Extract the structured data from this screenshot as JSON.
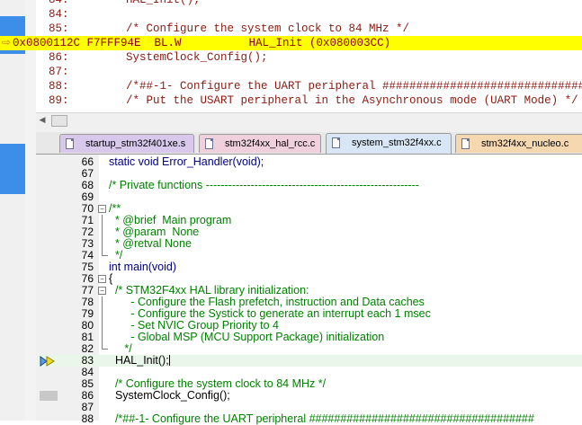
{
  "disassembly": {
    "lines": [
      {
        "num": "84:",
        "text": "    HAL_Init();",
        "highlight": false
      },
      {
        "num": "84:",
        "text": "",
        "highlight": false
      },
      {
        "num": "85:",
        "text": "    /* Configure the system clock to 84 MHz */",
        "highlight": false
      },
      {
        "num": "",
        "text": "0x0800112C F7FFF94E  BL.W          HAL_Init (0x080003CC)",
        "highlight": true
      },
      {
        "num": "86:",
        "text": "    SystemClock_Config();",
        "highlight": false
      },
      {
        "num": "87:",
        "text": "",
        "highlight": false
      },
      {
        "num": "88:",
        "text": "    /*##-1- Configure the UART peripheral ################################",
        "highlight": false
      },
      {
        "num": "89:",
        "text": "    /* Put the USART peripheral in the Asynchronous mode (UART Mode) */",
        "highlight": false
      }
    ],
    "pc_arrow": "⇨"
  },
  "tabs": [
    {
      "label": "startup_stm32f401xe.s",
      "bg": "#d8c8ec"
    },
    {
      "label": "stm32f4xx_hal_rcc.c",
      "bg": "#f0d0dc"
    },
    {
      "label": "system_stm32f4xx.c",
      "bg": "#d8e6f6"
    },
    {
      "label": "stm32f4xx_nucleo.c",
      "bg": "#f6d8b0"
    }
  ],
  "editor": {
    "lines": [
      {
        "num": "66",
        "parts": [
          {
            "t": "static void Error_Handler(void);",
            "c": "kw"
          }
        ]
      },
      {
        "num": "67",
        "parts": []
      },
      {
        "num": "68",
        "parts": [
          {
            "t": "/* Private functions ---------------------------------------------------------",
            "c": "cm"
          }
        ]
      },
      {
        "num": "69",
        "parts": []
      },
      {
        "num": "70",
        "parts": [
          {
            "t": "/**",
            "c": "cm"
          }
        ]
      },
      {
        "num": "71",
        "parts": [
          {
            "t": "  * @brief  Main program",
            "c": "cm"
          }
        ]
      },
      {
        "num": "72",
        "parts": [
          {
            "t": "  * @param  None",
            "c": "cm"
          }
        ]
      },
      {
        "num": "73",
        "parts": [
          {
            "t": "  * @retval None",
            "c": "cm"
          }
        ]
      },
      {
        "num": "74",
        "parts": [
          {
            "t": "  */",
            "c": "cm"
          }
        ]
      },
      {
        "num": "75",
        "parts": [
          {
            "t": "int main(void)",
            "c": "kw"
          }
        ]
      },
      {
        "num": "76",
        "parts": [
          {
            "t": "{",
            "c": ""
          }
        ]
      },
      {
        "num": "77",
        "parts": [
          {
            "t": "  /* STM32F4xx HAL library initialization:",
            "c": "cm"
          }
        ]
      },
      {
        "num": "78",
        "parts": [
          {
            "t": "       - Configure the Flash prefetch, instruction and Data caches",
            "c": "cm"
          }
        ]
      },
      {
        "num": "79",
        "parts": [
          {
            "t": "       - Configure the Systick to generate an interrupt each 1 msec",
            "c": "cm"
          }
        ]
      },
      {
        "num": "80",
        "parts": [
          {
            "t": "       - Set NVIC Group Priority to 4",
            "c": "cm"
          }
        ]
      },
      {
        "num": "81",
        "parts": [
          {
            "t": "       - Global MSP (MCU Support Package) initialization",
            "c": "cm"
          }
        ]
      },
      {
        "num": "82",
        "parts": [
          {
            "t": "     */",
            "c": "cm"
          }
        ]
      },
      {
        "num": "83",
        "parts": [
          {
            "t": "  HAL_Init();",
            "c": ""
          }
        ]
      },
      {
        "num": "84",
        "parts": []
      },
      {
        "num": "85",
        "parts": [
          {
            "t": "  /* Configure the system clock to 84 MHz */",
            "c": "cm"
          }
        ]
      },
      {
        "num": "86",
        "parts": [
          {
            "t": "  SystemClock_Config();",
            "c": ""
          }
        ]
      },
      {
        "num": "87",
        "parts": []
      },
      {
        "num": "88",
        "parts": [
          {
            "t": "  /*##-1- Configure the UART peripheral ####################################",
            "c": "cm"
          }
        ]
      }
    ]
  },
  "colors": {
    "highlight": "#ffff00",
    "current_line": "#e9f6e9",
    "accent": "#3c8ee8"
  }
}
